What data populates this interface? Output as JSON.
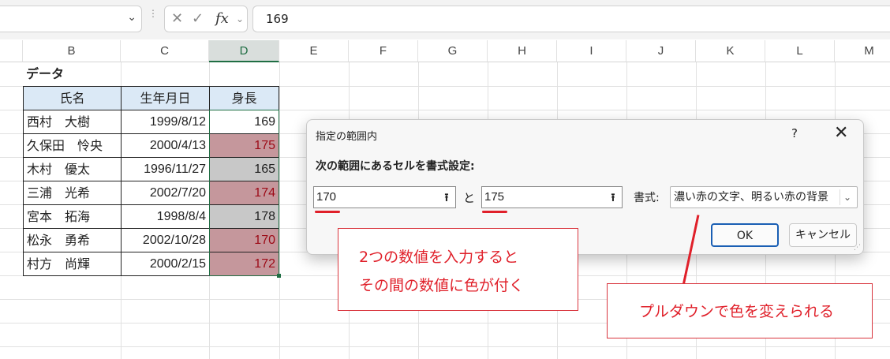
{
  "formula_bar": {
    "value": "169",
    "fx_label": "fx"
  },
  "columns": [
    "B",
    "C",
    "D",
    "E",
    "F",
    "G",
    "H",
    "I",
    "J",
    "K",
    "L",
    "M"
  ],
  "section_title": "データ",
  "table": {
    "headers": [
      "氏名",
      "生年月日",
      "身長"
    ],
    "rows": [
      {
        "name": "西村　大樹",
        "date": "1999/8/12",
        "height": "169",
        "fill": "none"
      },
      {
        "name": "久保田　怜央",
        "date": "2000/4/13",
        "height": "175",
        "fill": "pink"
      },
      {
        "name": "木村　優太",
        "date": "1996/11/27",
        "height": "165",
        "fill": "grey"
      },
      {
        "name": "三浦　光希",
        "date": "2002/7/20",
        "height": "174",
        "fill": "pink"
      },
      {
        "name": "宮本　拓海",
        "date": "1998/8/4",
        "height": "178",
        "fill": "grey"
      },
      {
        "name": "松永　勇希",
        "date": "2002/10/28",
        "height": "170",
        "fill": "pink"
      },
      {
        "name": "村方　尚輝",
        "date": "2000/2/15",
        "height": "172",
        "fill": "pink"
      }
    ]
  },
  "dialog": {
    "title": "指定の範囲内",
    "help": "?",
    "instruction": "次の範囲にあるセルを書式設定:",
    "from_value": "170",
    "to_label": "と",
    "to_value": "175",
    "format_label": "書式:",
    "format_selected": "濃い赤の文字、明るい赤の背景",
    "ok_label": "OK",
    "cancel_label": "キャンセル"
  },
  "annotations": {
    "callout1_line1": "2つの数値を入力すると",
    "callout1_line2": "その間の数値に色が付く",
    "callout2": "プルダウンで色を変えられる"
  },
  "colors": {
    "accent_red": "#e0202a",
    "selection_green": "#1f6e43",
    "pink_fill": "#c5979c",
    "grey_fill": "#c8c8c8",
    "header_fill": "#dbe9f6"
  }
}
